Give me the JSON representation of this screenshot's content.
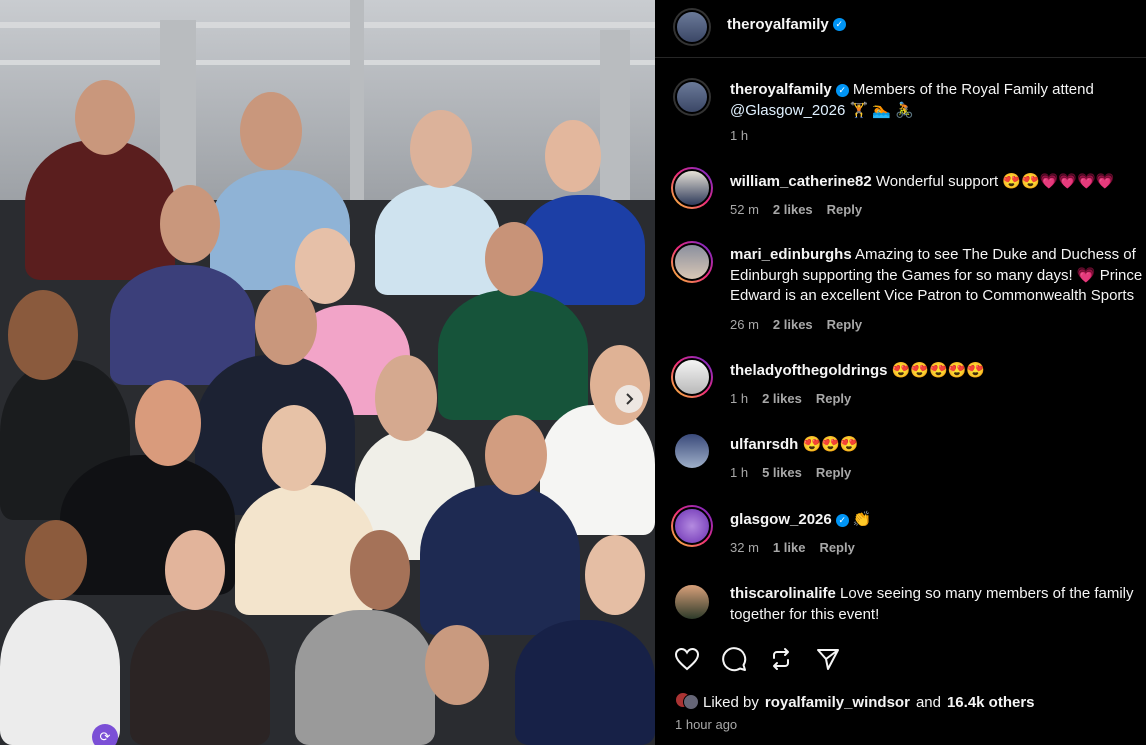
{
  "post": {
    "author": "theroyalfamily",
    "caption_author": "theroyalfamily",
    "caption_line1": "Members of the Royal Family attend",
    "caption_mention": "@Glasgow_2026",
    "caption_emojis": "🏋️ 🏊 🚴",
    "caption_time": "1 h"
  },
  "comments": [
    {
      "user": "william_catherine82",
      "line1": "Wonderful support 😍😍💗💗💗💗",
      "line2": "",
      "time": "52 m",
      "likes": "2 likes",
      "reply": "Reply",
      "verified": false
    },
    {
      "user": "mari_edinburghs",
      "line1": "Amazing to see The Duke and Duchess of",
      "line2": "Edinburgh supporting the Games for so many days! 💗 Prince",
      "line3": "Edward is an excellent Vice Patron to Commonwealth Sports",
      "time": "26 m",
      "likes": "2 likes",
      "reply": "Reply",
      "verified": false
    },
    {
      "user": "theladyofthegoldrings",
      "line1": "😍😍😍😍😍",
      "time": "1 h",
      "likes": "2 likes",
      "reply": "Reply",
      "verified": false
    },
    {
      "user": "ulfanrsdh",
      "line1": "😍😍😍",
      "time": "1 h",
      "likes": "5 likes",
      "reply": "Reply",
      "verified": false
    },
    {
      "user": "glasgow_2026",
      "line1": "👏",
      "time": "32 m",
      "likes": "1 like",
      "reply": "Reply",
      "verified": true
    },
    {
      "user": "thiscarolinalife",
      "line1": "Love seeing so many members of the family",
      "line2": "together for this event!",
      "verified": false
    }
  ],
  "footer": {
    "liked_prefix": "Liked by",
    "liked_user": "royalfamily_windsor",
    "liked_and": "and",
    "liked_others": "16.4k others",
    "time_ago": "1 hour ago"
  },
  "icons": [
    "heart-icon",
    "comment-icon",
    "repost-icon",
    "share-icon",
    "chevron-right-icon",
    "people-tag-icon",
    "verified-icon"
  ],
  "colors": {
    "background": "#000000",
    "verified": "#0095f6",
    "meta": "#a8a8a8"
  }
}
